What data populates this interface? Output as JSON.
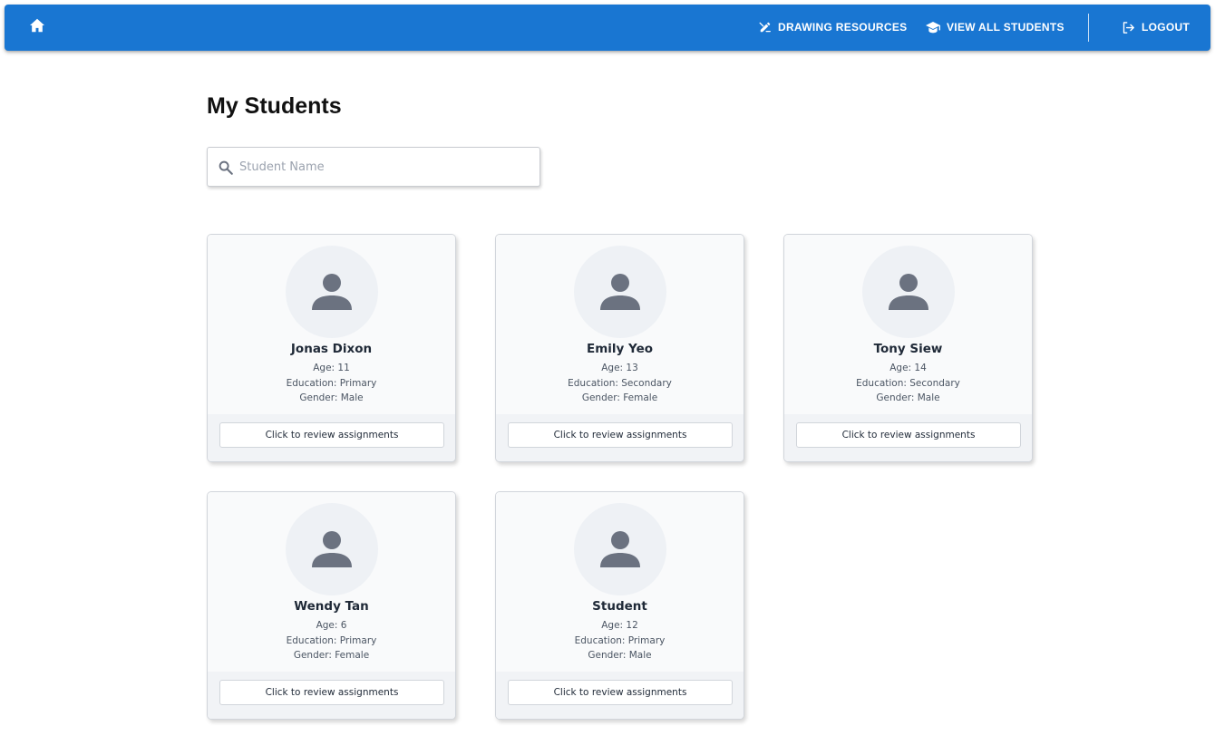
{
  "nav": {
    "home_icon": "home-icon",
    "drawing_label": "DRAWING RESOURCES",
    "drawing_icon": "draw-icon",
    "students_label": "VIEW ALL STUDENTS",
    "students_icon": "graduation-cap-icon",
    "logout_label": "LOGOUT",
    "logout_icon": "logout-icon",
    "bar_color": "#1976d2"
  },
  "page": {
    "title": "My Students"
  },
  "search": {
    "placeholder": "Student Name",
    "value": "",
    "icon": "search-icon"
  },
  "students": [
    {
      "name": "Jonas Dixon",
      "age": "Age: 11",
      "education": "Education: Primary",
      "gender": "Gender: Male",
      "button": "Click to review assignments"
    },
    {
      "name": "Emily Yeo",
      "age": "Age: 13",
      "education": "Education: Secondary",
      "gender": "Gender: Female",
      "button": "Click to review assignments"
    },
    {
      "name": "Tony Siew",
      "age": "Age: 14",
      "education": "Education: Secondary",
      "gender": "Gender: Male",
      "button": "Click to review assignments"
    },
    {
      "name": "Wendy Tan",
      "age": "Age: 6",
      "education": "Education: Primary",
      "gender": "Gender: Female",
      "button": "Click to review assignments"
    },
    {
      "name": "Student",
      "age": "Age: 12",
      "education": "Education: Primary",
      "gender": "Gender: Male",
      "button": "Click to review assignments"
    }
  ]
}
